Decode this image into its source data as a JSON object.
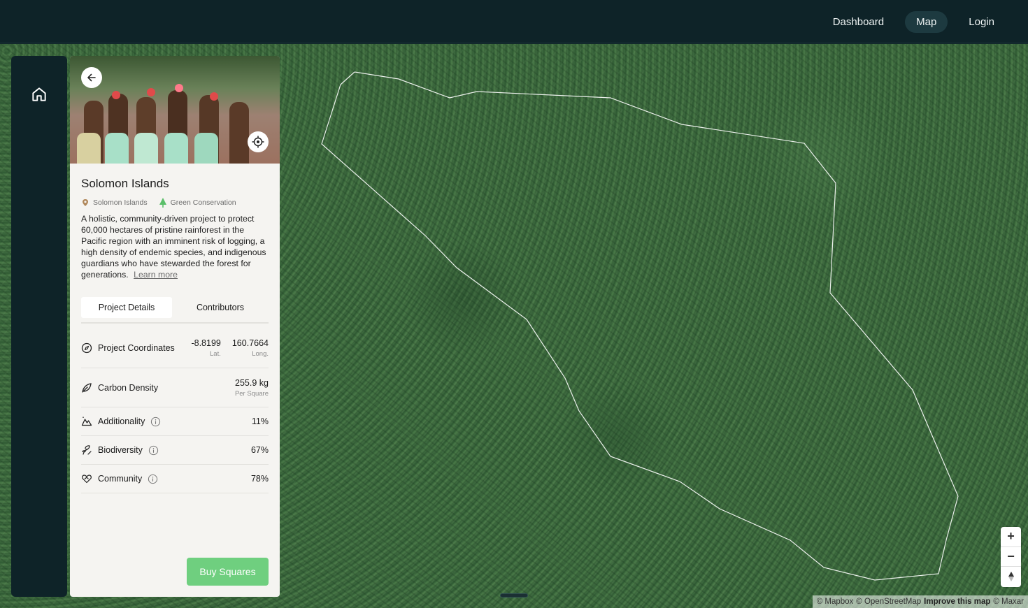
{
  "nav": {
    "items": [
      {
        "label": "Dashboard",
        "active": false
      },
      {
        "label": "Map",
        "active": true
      },
      {
        "label": "Login",
        "active": false
      }
    ]
  },
  "sidebar": {
    "home_icon": "home-icon"
  },
  "project": {
    "title": "Solomon Islands",
    "location_tag": "Solomon Islands",
    "category_tag": "Green Conservation",
    "description": "A holistic, community-driven project to protect 60,000 hectares of pristine rainforest in the Pacific region with an imminent risk of logging, a high density of endemic species, and indigenous guardians who have stewarded the forest for generations.",
    "learn_more": "Learn more",
    "tabs": [
      {
        "label": "Project Details",
        "active": true
      },
      {
        "label": "Contributors",
        "active": false
      }
    ],
    "details": {
      "coordinates": {
        "label": "Project Coordinates",
        "lat": "-8.8199",
        "lat_label": "Lat.",
        "long": "160.7664",
        "long_label": "Long."
      },
      "carbon": {
        "label": "Carbon Density",
        "value": "255.9 kg",
        "sub": "Per Square"
      },
      "additionality": {
        "label": "Additionality",
        "value": "11%"
      },
      "biodiversity": {
        "label": "Biodiversity",
        "value": "67%"
      },
      "community": {
        "label": "Community",
        "value": "78%"
      }
    },
    "buy_button": "Buy Squares"
  },
  "map": {
    "zoom_in": "+",
    "zoom_out": "−",
    "attribution": {
      "mapbox": "© Mapbox",
      "osm": "© OpenStreetMap",
      "improve": "Improve this map",
      "maxar": "© Maxar"
    }
  },
  "colors": {
    "topbar": "#0e2328",
    "accent": "#6fcf7f",
    "panel": "#f5f4f1"
  }
}
